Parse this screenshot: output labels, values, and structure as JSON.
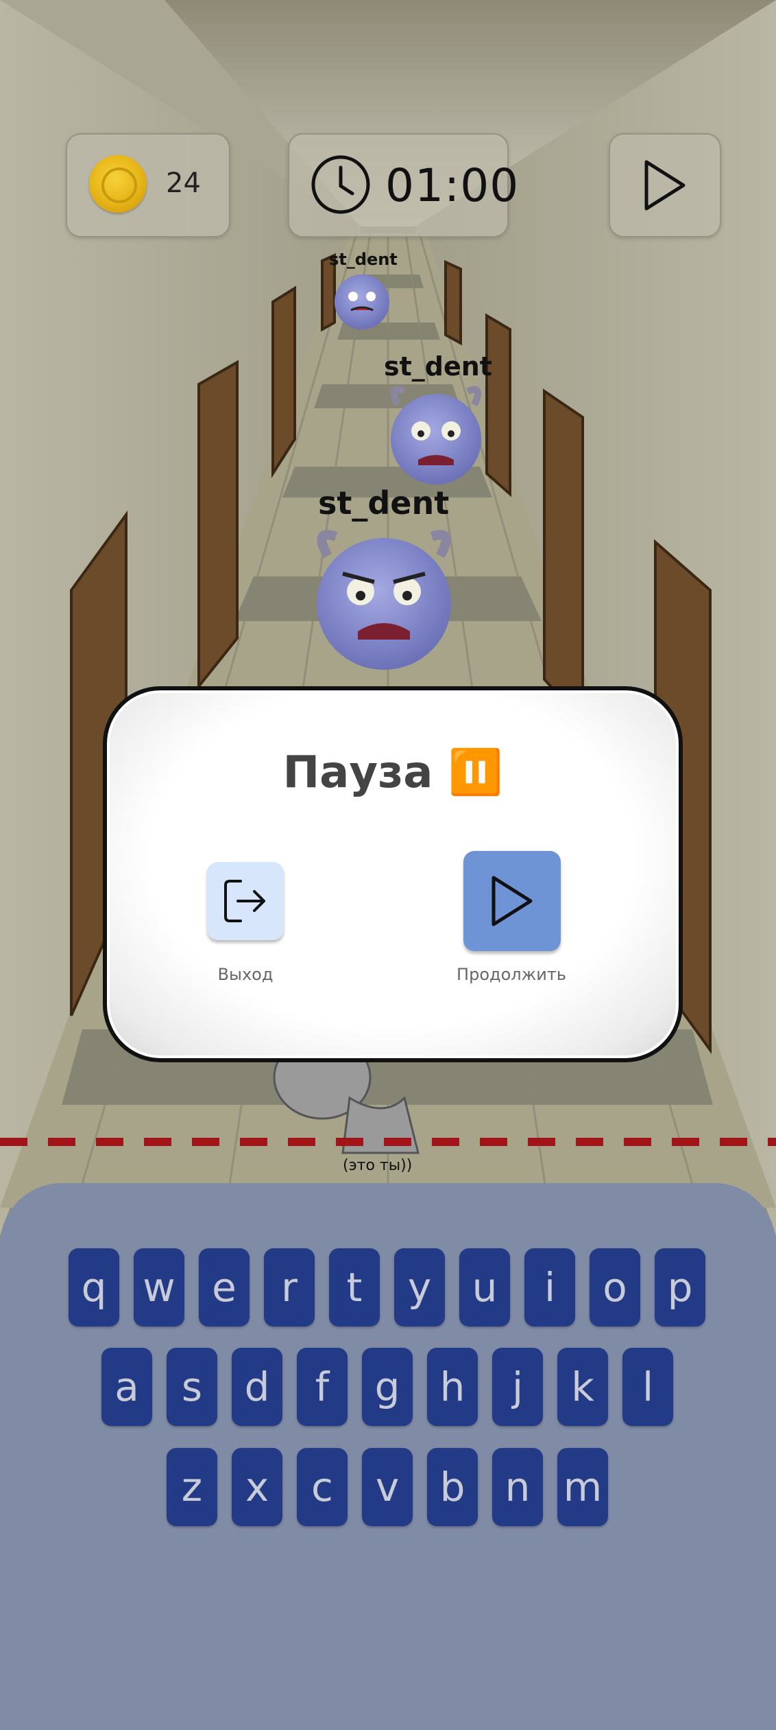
{
  "hud": {
    "coins": "24",
    "timer": "01:00",
    "play_icon": "play-icon",
    "coin_icon": "coin-icon",
    "clock_icon": "clock-icon"
  },
  "monsters": [
    {
      "label": "st_dent"
    },
    {
      "label": "st_dent"
    },
    {
      "label": "st_dent"
    }
  ],
  "player_label": "(это ты))",
  "pause_dialog": {
    "title": "Пауза ⏸️",
    "exit_label": "Выход",
    "continue_label": "Продолжить",
    "exit_icon": "exit-icon",
    "continue_icon": "play-icon"
  },
  "keyboard": {
    "rows": [
      [
        "q",
        "w",
        "e",
        "r",
        "t",
        "y",
        "u",
        "i",
        "o",
        "p"
      ],
      [
        "a",
        "s",
        "d",
        "f",
        "g",
        "h",
        "j",
        "k",
        "l"
      ],
      [
        "z",
        "x",
        "c",
        "v",
        "b",
        "n",
        "m"
      ]
    ]
  },
  "colors": {
    "key_bg": "#233a86",
    "keyboard_bg": "#808ba6",
    "continue_btn": "#6f94d6",
    "exit_btn": "#d7e6fb",
    "finish_line": "#a0141a"
  }
}
